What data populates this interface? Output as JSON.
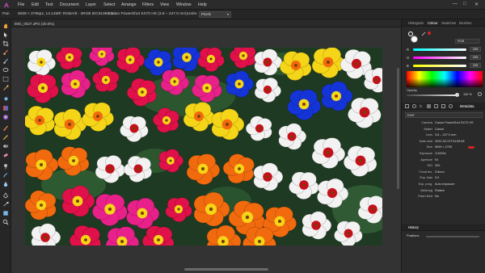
{
  "menubar": {
    "items": [
      "File",
      "Edit",
      "Text",
      "Document",
      "Layer",
      "Select",
      "Arrange",
      "Filters",
      "View",
      "Window",
      "Help"
    ]
  },
  "contextbar": {
    "tool_name": "Pan",
    "doc_info": "5059 × 2795px, 14.14MP, RGBA/8 · sRGB IEC61966-2.1",
    "camera_info": "Canon PowerShot SX70 HS  (3.8 – 247.0 mm)",
    "units_label": "Units:",
    "units_value": "Pixels"
  },
  "document": {
    "tab_title": "IMG_0027.JPG (20.0%)"
  },
  "top_panel": {
    "tabs": [
      "Histogram",
      "Colour",
      "Swatches",
      "Brushes"
    ],
    "active_tab": "Colour",
    "color_model": "RGB",
    "sliders": [
      {
        "label": "R",
        "value": "255"
      },
      {
        "label": "G",
        "value": "255"
      },
      {
        "label": "B",
        "value": "255"
      }
    ],
    "opacity_label": "Opacity",
    "opacity_value": "100 %"
  },
  "meta_panel": {
    "active_tab": "Metadata",
    "section": "EXIF",
    "rows": [
      {
        "key": "Camera",
        "value": "Canon PowerShot SX70 HS"
      },
      {
        "key": "Maker",
        "value": "Canon"
      },
      {
        "key": "Lens",
        "value": "3.8 – 247.0 mm"
      },
      {
        "key": "Date shot",
        "value": "2020-02-21T04:59:08"
      },
      {
        "key": "Size",
        "value": "5059 × 2795"
      },
      {
        "key": "Exposure",
        "value": "1/1000s"
      },
      {
        "key": "Aperture",
        "value": "f/4"
      },
      {
        "key": "ISO",
        "value": "200"
      },
      {
        "key": "Focal len.",
        "value": "3.8mm"
      },
      {
        "key": "Exp. bias",
        "value": "0.0"
      },
      {
        "key": "Exp. prog.",
        "value": "Auto exposure"
      },
      {
        "key": "Metering",
        "value": "Pattern"
      },
      {
        "key": "Flash fired",
        "value": "No"
      }
    ]
  },
  "history_panel": {
    "tab": "History",
    "entry": "Positions"
  },
  "colors": {
    "accent_red": "#d12424",
    "panel_bg": "#2a2a2a",
    "canvas_bg": "#333333"
  }
}
